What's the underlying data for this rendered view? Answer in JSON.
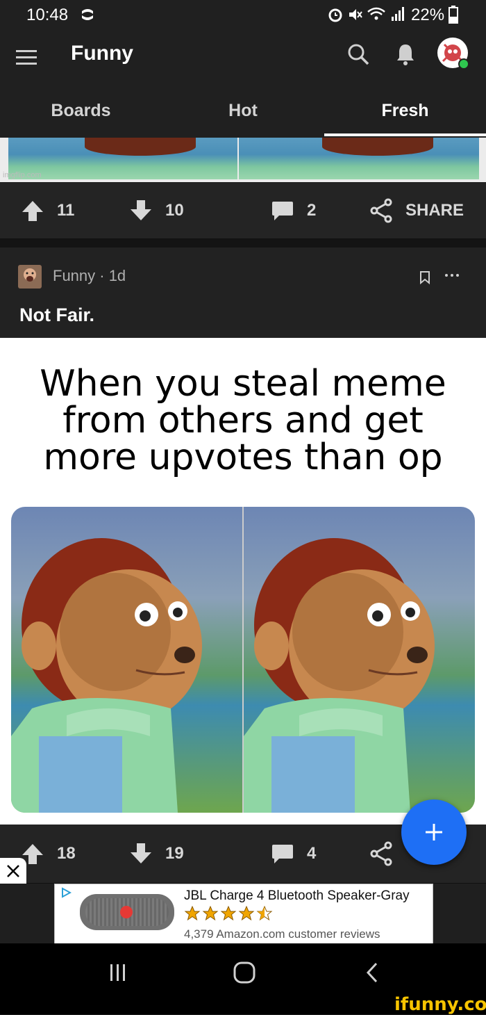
{
  "status": {
    "time": "10:48",
    "battery": "22%"
  },
  "appbar": {
    "title": "Funny"
  },
  "tabs": [
    {
      "label": "Boards"
    },
    {
      "label": "Hot"
    },
    {
      "label": "Fresh"
    }
  ],
  "prev_post": {
    "watermark": "imgflip.com",
    "upvotes": "11",
    "downvotes": "10",
    "comments": "2",
    "share_label": "SHARE"
  },
  "post": {
    "board": "Funny",
    "age": "1d",
    "meta": "Funny · 1d",
    "title": "Not Fair.",
    "meme_text": "When you steal meme from others and get more upvotes than op",
    "upvotes": "18",
    "downvotes": "19",
    "comments": "4"
  },
  "ad": {
    "product": "JBL Charge 4 Bluetooth Speaker-Gray",
    "rating": 4.5,
    "reviews": "4,379 Amazon.com customer reviews"
  },
  "watermark": "ifunny.co",
  "colors": {
    "fab": "#1e6ff5",
    "watermark": "#f7c400"
  }
}
